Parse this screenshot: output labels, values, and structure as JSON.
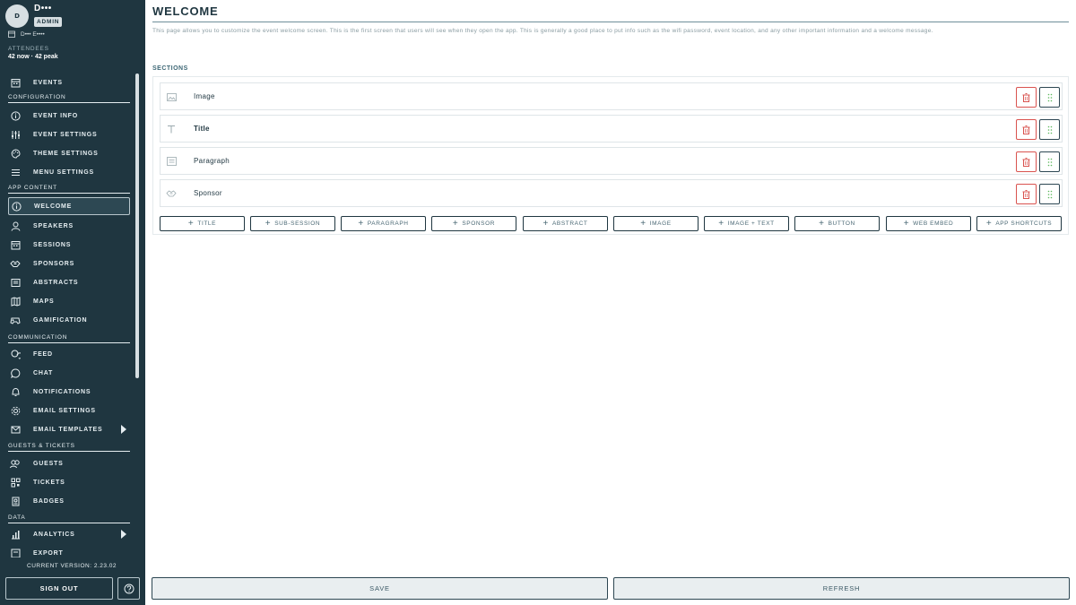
{
  "user": {
    "initial": "D",
    "name": "D•••",
    "role": "ADMIN",
    "event": "D••• E••••"
  },
  "attendees": {
    "label": "ATTENDEES",
    "value": "42 now · 42 peak"
  },
  "nav": {
    "events": "EVENTS",
    "configuration": "CONFIGURATION",
    "event_info": "EVENT INFO",
    "event_settings": "EVENT SETTINGS",
    "theme_settings": "THEME SETTINGS",
    "menu_settings": "MENU SETTINGS",
    "app_content": "APP CONTENT",
    "welcome": "WELCOME",
    "speakers": "SPEAKERS",
    "sessions": "SESSIONS",
    "sponsors": "SPONSORS",
    "abstracts": "ABSTRACTS",
    "maps": "MAPS",
    "gamification": "GAMIFICATION",
    "communication": "COMMUNICATION",
    "feed": "FEED",
    "chat": "CHAT",
    "notifications": "NOTIFICATIONS",
    "email_settings": "EMAIL SETTINGS",
    "email_templates": "EMAIL TEMPLATES",
    "guests_tickets": "GUESTS & TICKETS",
    "guests": "GUESTS",
    "tickets": "TICKETS",
    "badges": "BADGES",
    "data": "DATA",
    "analytics": "ANALYTICS",
    "export": "EXPORT"
  },
  "footer": {
    "version": "CURRENT VERSION: 2.23.02",
    "sign_out": "SIGN OUT"
  },
  "page": {
    "title": "WELCOME",
    "description": "This page allows you to customize the event welcome screen. This is the first screen that users will see when they open the app. This is generally a good place to put info such as the wifi password, event location, and any other important information and a welcome message.",
    "sections_label": "SECTIONS",
    "sections": [
      {
        "label": "Image",
        "icon": "image-icon"
      },
      {
        "label": "Title",
        "icon": "text-t-icon"
      },
      {
        "label": "Paragraph",
        "icon": "paragraph-icon"
      },
      {
        "label": "Sponsor",
        "icon": "handshake-icon"
      }
    ],
    "add_buttons": [
      "TITLE",
      "SUB-SESSION",
      "PARAGRAPH",
      "SPONSOR",
      "ABSTRACT",
      "IMAGE",
      "IMAGE + TEXT",
      "BUTTON",
      "WEB EMBED",
      "APP SHORTCUTS"
    ],
    "save": "SAVE",
    "refresh": "REFRESH"
  },
  "colors": {
    "sidebar": "#1f3640",
    "accent": "#3d6775",
    "danger": "#d9534f",
    "drag": "#5cb85c"
  }
}
